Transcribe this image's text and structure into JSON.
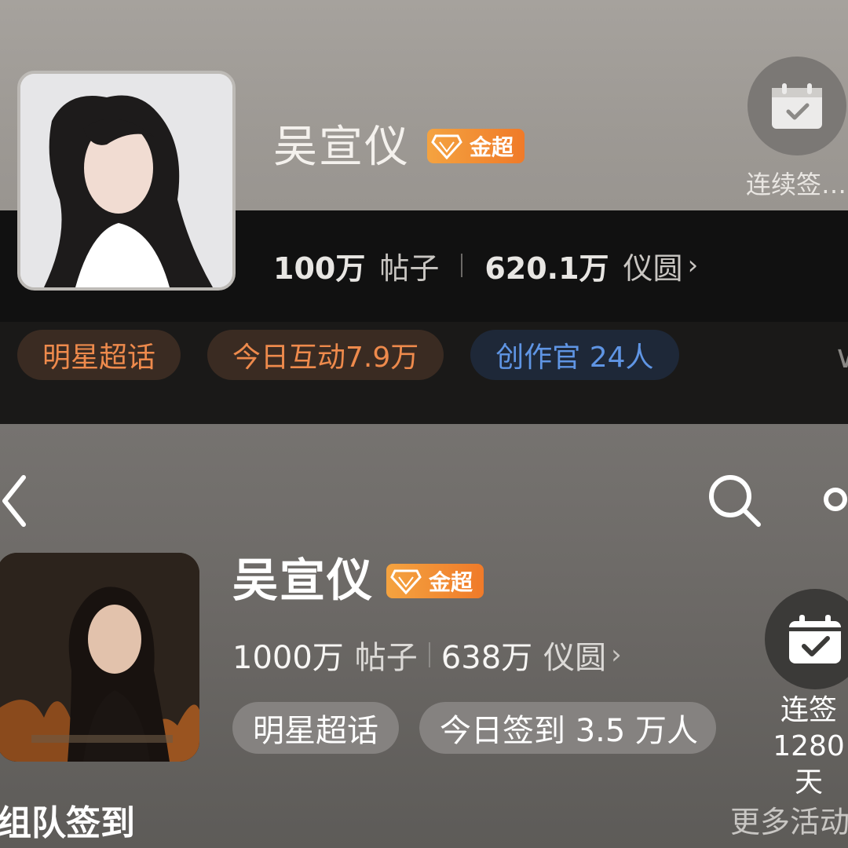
{
  "top_card": {
    "name": "吴宣仪",
    "badge": "金超",
    "posts_count": "100万",
    "posts_label": "帖子",
    "coins_count": "620.1万",
    "coins_label": "仪圆",
    "checkin_label": "连续签…",
    "chips": [
      "明星超话",
      "今日互动7.9万",
      "创作官 24人"
    ]
  },
  "bottom_card": {
    "name": "吴宣仪",
    "badge": "金超",
    "posts_count": "1000万",
    "posts_label": "帖子",
    "coins_count": "638万",
    "coins_label": "仪圆",
    "chips": [
      "明星超话",
      "今日签到 3.5 万人"
    ],
    "checkin_line1": "连签",
    "checkin_line2": "1280天",
    "team_checkin": "组队签到",
    "more_activities": "更多活动"
  },
  "colors": {
    "badge_gradient_start": "#f4a340",
    "badge_gradient_end": "#f07a29",
    "chip_orange_text": "#ee8a4c",
    "chip_blue_text": "#5f95e4"
  },
  "icons": [
    "calendar-check-icon",
    "back-arrow-icon",
    "search-icon",
    "share-icon",
    "gem-icon",
    "chevron-right-icon",
    "chevron-down-icon"
  ]
}
